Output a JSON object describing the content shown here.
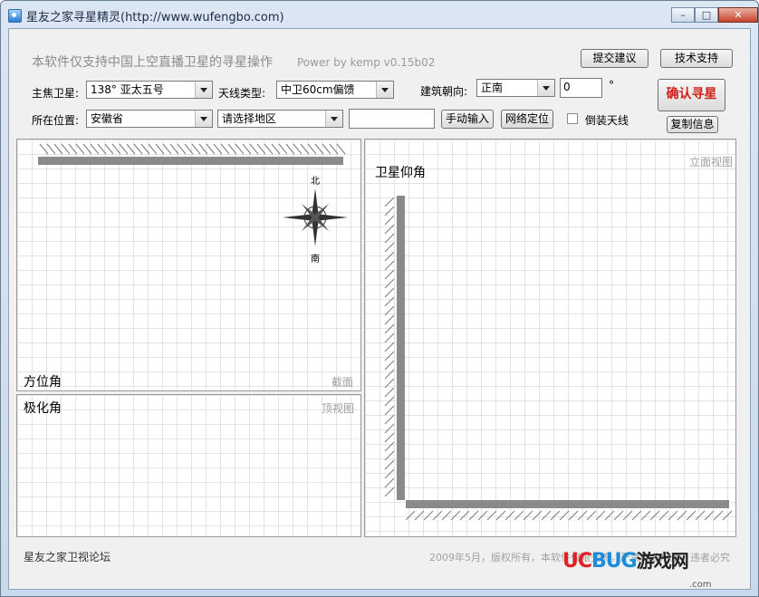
{
  "window": {
    "title": "星友之家寻星精灵(http://www.wufengbo.com)",
    "minimize": "–",
    "maximize": "□",
    "close": "✕"
  },
  "header": {
    "notice": "本软件仅支持中国上空直播卫星的寻星操作",
    "power": "Power by kemp  v0.15b02",
    "suggest_button": "提交建议",
    "support_button": "技术支持"
  },
  "form": {
    "satellite_label": "主焦卫星:",
    "satellite_value": "138°   亚太五号",
    "antenna_label": "天线类型:",
    "antenna_value": "中卫60cm偏馈",
    "orientation_label": "建筑朝向:",
    "orientation_value": "正南",
    "angle_value": "0",
    "degree_symbol": "°",
    "location_label": "所在位置:",
    "province_value": "安徽省",
    "region_value": "请选择地区",
    "manual_input_button": "手动输入",
    "network_locate_button": "网络定位",
    "inverted_label": "倒装天线",
    "inverted_checked": false,
    "confirm_button": "确认寻星",
    "copy_info_button": "复制信息"
  },
  "panels": {
    "azimuth_title": "方位角",
    "azimuth_note": "截面",
    "compass_north": "北",
    "compass_south": "南",
    "polarization_title": "极化角",
    "polarization_note": "顶视图",
    "elevation_title": "卫星仰角",
    "elevation_note": "立面视图"
  },
  "footer": {
    "forum": "星友之家卫视论坛",
    "copyright": "2009年5月，版权所有，本软件仅限交流，严禁商业用途，违者必究"
  },
  "watermark": {
    "brand_a": "UC",
    "brand_b": "BUG",
    "brand_c": "游戏网",
    "domain": ".com"
  },
  "colors": {
    "confirm_text": "#d0201a",
    "watermark_red": "#e31e24",
    "watermark_blue": "#1a8cd8"
  }
}
